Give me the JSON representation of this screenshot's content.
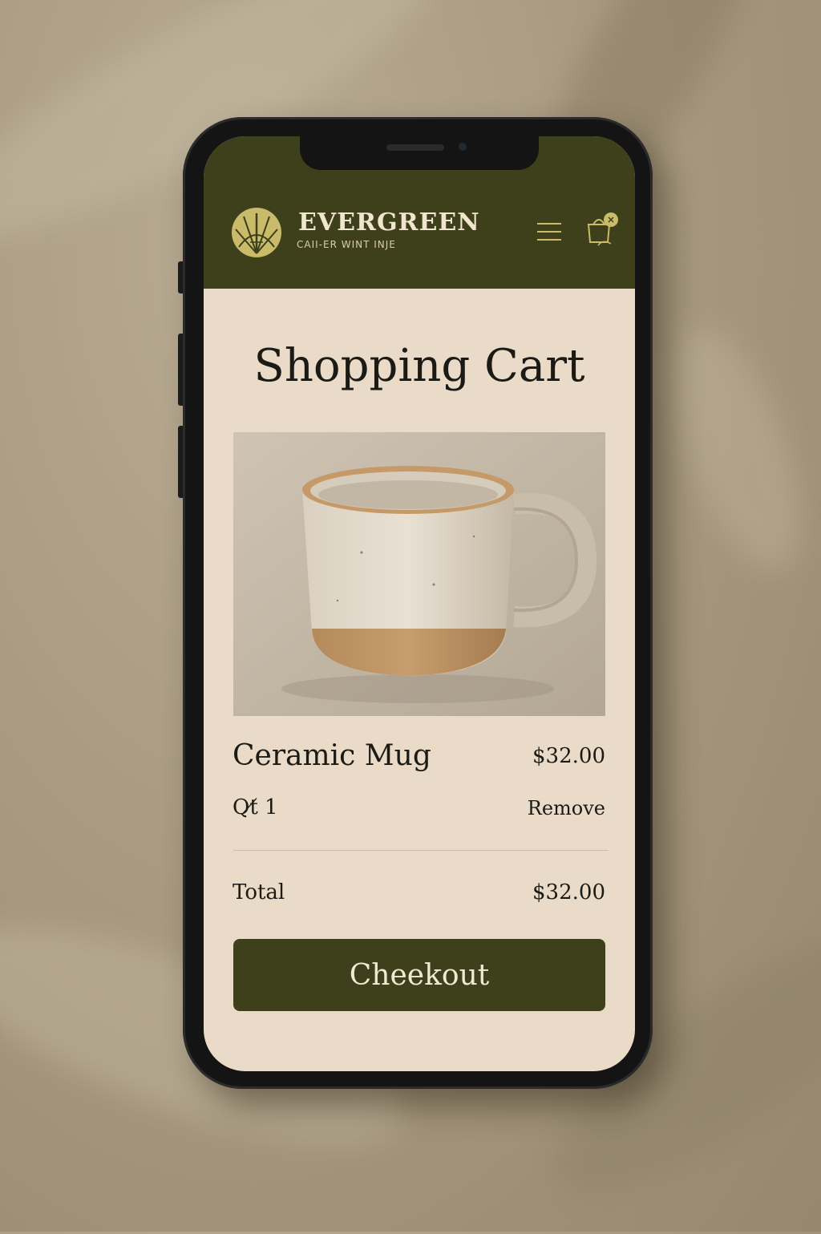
{
  "brand": {
    "name": "EVERGREEN",
    "tagline": "CAII-ER WINT INJE",
    "logo_icon": "leaf-shell-icon"
  },
  "header": {
    "menu_icon": "hamburger-menu-icon",
    "cart_icon": "shopping-bag-icon"
  },
  "page": {
    "title": "Shopping Cart"
  },
  "cart": {
    "items": [
      {
        "name": "Ceramic Mug",
        "price": "$32.00",
        "quantity_label": "Qt̸ 1",
        "remove_label": "Remove",
        "image_icon": "ceramic-mug-photo"
      }
    ],
    "total_label": "Total",
    "total_value": "$32.00",
    "checkout_label": "Cheekout"
  },
  "colors": {
    "header_bg": "#3e3f1b",
    "screen_bg": "#e9dbc7",
    "accent_gold": "#c9bb6a",
    "text_dark": "#1b1a15",
    "button_text": "#f2e9d5"
  }
}
